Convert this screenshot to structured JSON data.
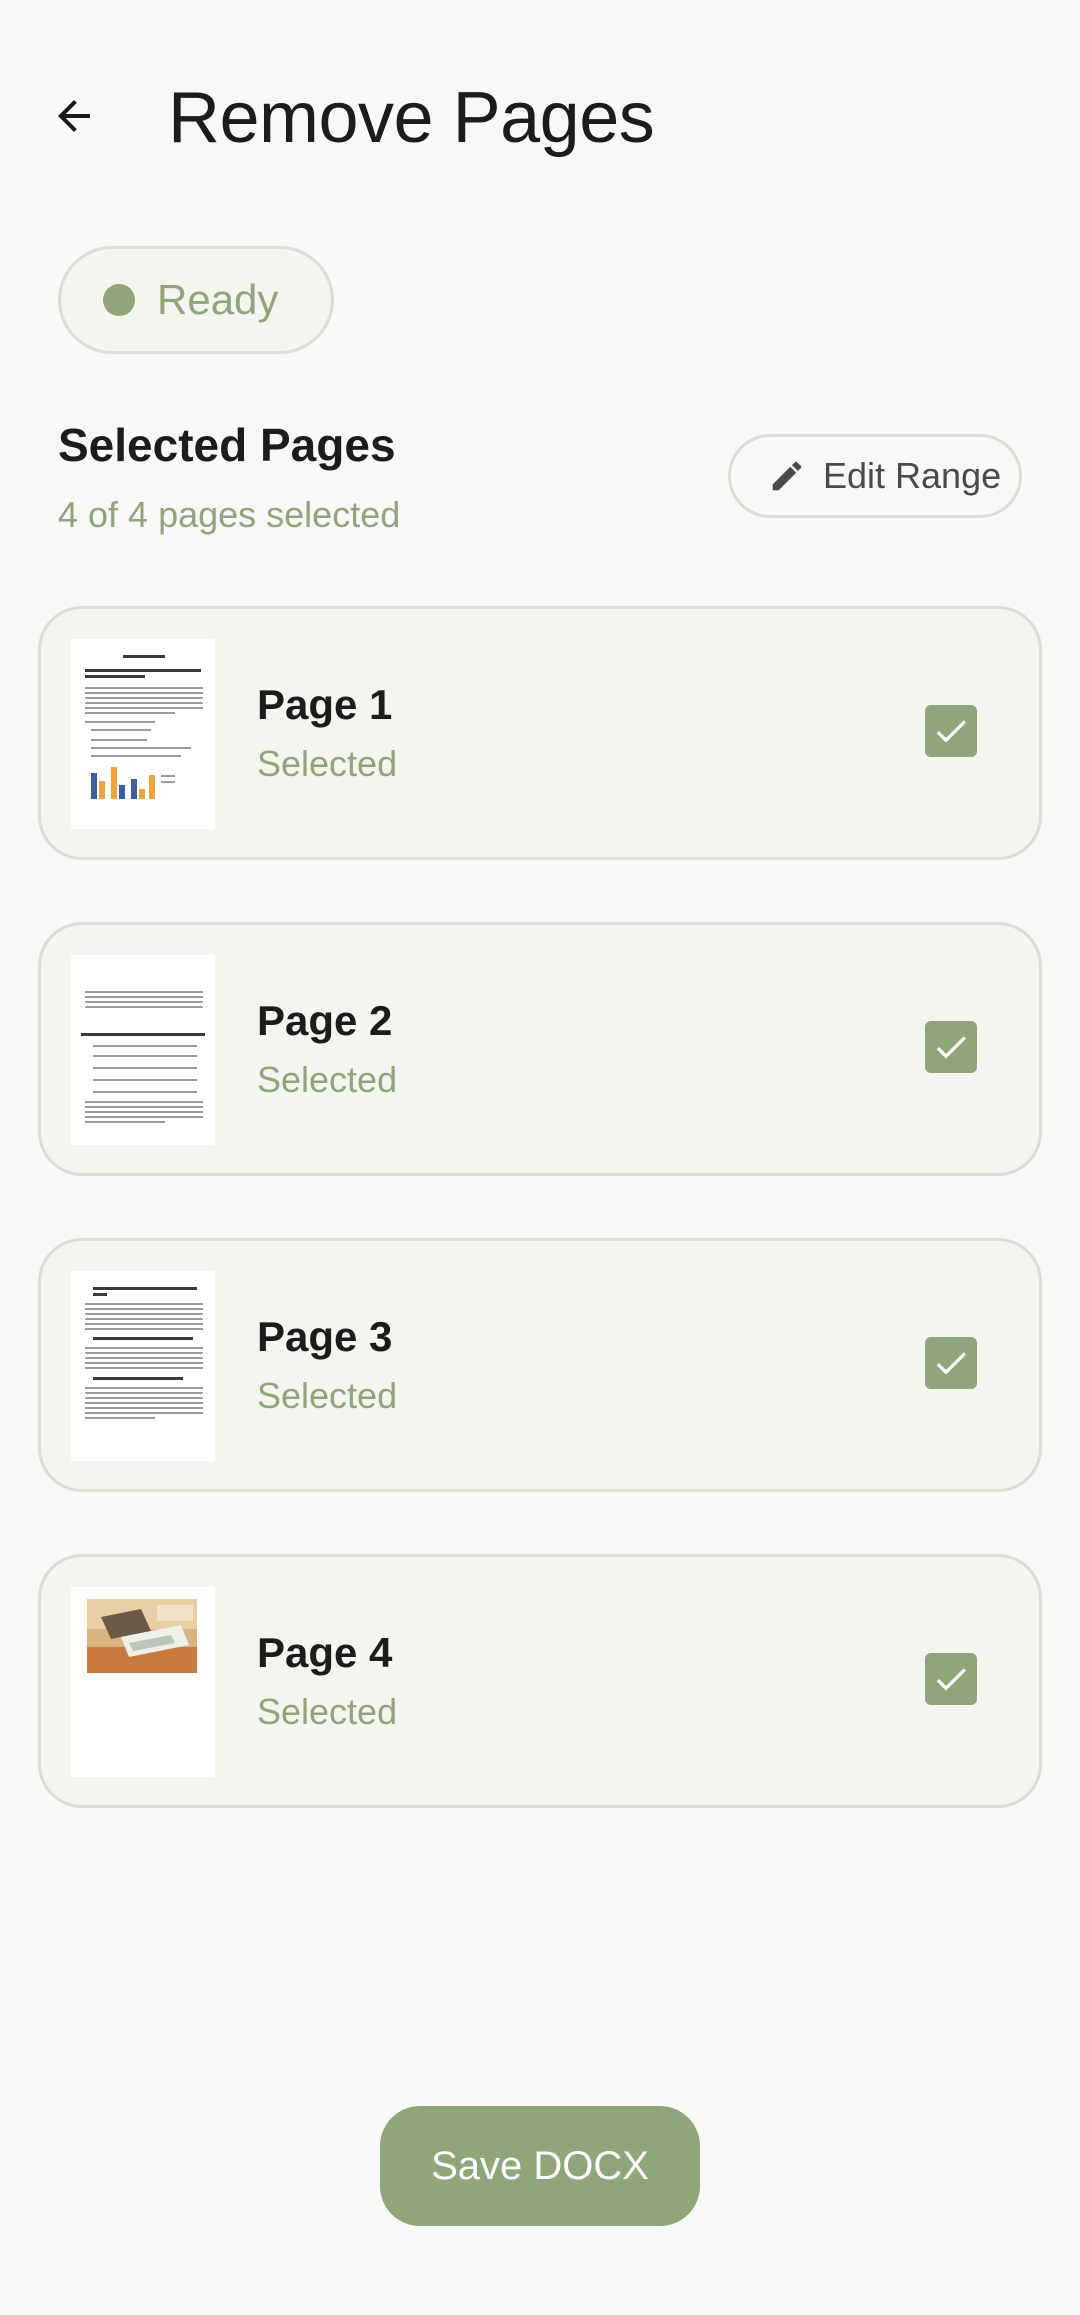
{
  "header": {
    "title": "Remove Pages",
    "back_icon": "arrow-left-icon"
  },
  "status": {
    "label": "Ready",
    "color": "#8fa57a"
  },
  "selection": {
    "title": "Selected Pages",
    "summary": "4 of 4 pages selected",
    "edit_range_label": "Edit Range",
    "edit_icon": "pencil-icon"
  },
  "pages": [
    {
      "name": "Page 1",
      "state": "Selected",
      "checked": true
    },
    {
      "name": "Page 2",
      "state": "Selected",
      "checked": true
    },
    {
      "name": "Page 3",
      "state": "Selected",
      "checked": true
    },
    {
      "name": "Page 4",
      "state": "Selected",
      "checked": true
    }
  ],
  "actions": {
    "save_label": "Save DOCX"
  },
  "colors": {
    "accent": "#8fa57a",
    "background": "#f8f8f6",
    "card": "#f4f5ef",
    "border": "#d9ddd2"
  }
}
